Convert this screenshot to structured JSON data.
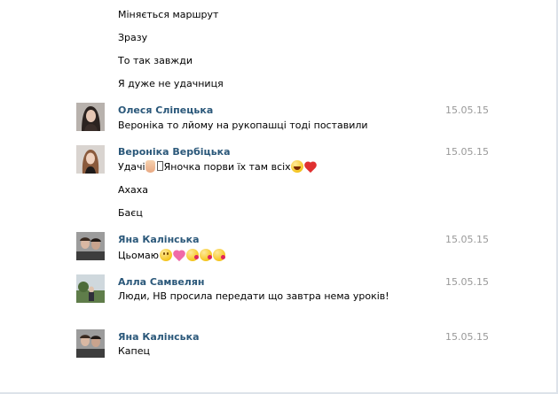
{
  "messages": [
    {
      "text": "Міняється маршрут"
    },
    {
      "text": "Зразу"
    },
    {
      "text": "То так завжди"
    },
    {
      "text": "Я дуже не удачниця"
    },
    {
      "author": "Олеся Сліпецька",
      "date": "15.05.15",
      "text": "Вероніка то лйому на рукопашці тоді поставили"
    },
    {
      "author": "Вероніка Вербіцька",
      "date": "15.05.15",
      "text_a": "Удачі",
      "text_b": "Яночка порви їх там всіх"
    },
    {
      "text": "Ахаха"
    },
    {
      "text": "Баєц"
    },
    {
      "author": "Яна Калінська",
      "date": "15.05.15",
      "text": "Цьомаю"
    },
    {
      "author": "Алла Самвелян",
      "date": "15.05.15",
      "text": "Люди, НВ просила передати що завтра нема уроків!"
    },
    {
      "author": "Яна Калінська",
      "date": "15.05.15",
      "text": "Капец"
    }
  ],
  "icons": [
    "raised-hand-emoji",
    "laughing-emoji",
    "red-heart-emoji",
    "smiling-emoji",
    "pink-heart-emoji",
    "kissing-emoji"
  ],
  "colors": {
    "author": "#2b587a",
    "date": "#999999",
    "text": "#000000"
  }
}
